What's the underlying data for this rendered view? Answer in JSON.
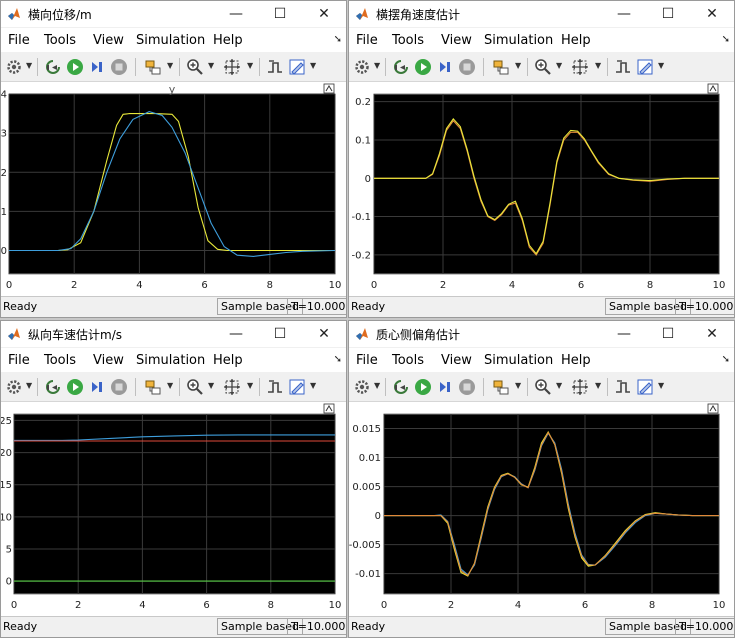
{
  "menu": [
    "File",
    "Tools",
    "View",
    "Simulation",
    "Help"
  ],
  "status": {
    "ready": "Ready",
    "sample": "Sample based",
    "time": "T=10.000"
  },
  "colors": {
    "yellow": "#e8e83a",
    "blue": "#3e9edc",
    "red": "#e04a3a",
    "green": "#5ad048",
    "orange": "#e0883a",
    "grid": "#3a3a3a",
    "bg": "#000000"
  },
  "scopes": [
    {
      "id": "scope1",
      "title": "横向位移/m",
      "axis_title": "y",
      "chart_data": {
        "type": "line",
        "xlim": [
          0,
          10
        ],
        "ylim": [
          -0.6,
          4.0
        ],
        "xticks": [
          0,
          2,
          4,
          6,
          8,
          10
        ],
        "yticks": [
          0,
          1,
          2,
          3,
          4
        ],
        "xtick_labels": [
          "0",
          "2",
          "4",
          "6",
          "8",
          "10"
        ],
        "ytick_labels": [
          "0",
          "1",
          "2",
          "3",
          "4"
        ],
        "grid": true,
        "series": [
          {
            "color": "yellow",
            "x": [
              0,
              1.5,
              1.8,
              2.2,
              2.6,
              3.0,
              3.3,
              3.5,
              3.7,
              4.5,
              5.0,
              5.2,
              5.5,
              5.8,
              6.1,
              6.4,
              6.7,
              7,
              8,
              9,
              10
            ],
            "y": [
              0,
              0,
              0.02,
              0.2,
              1.0,
              2.3,
              3.2,
              3.48,
              3.5,
              3.5,
              3.48,
              3.3,
              2.4,
              1.1,
              0.25,
              0.03,
              0,
              0,
              0,
              0,
              0
            ]
          },
          {
            "color": "blue",
            "x": [
              0,
              1.5,
              1.9,
              2.2,
              2.6,
              3.0,
              3.4,
              3.8,
              4.3,
              4.7,
              5.0,
              5.4,
              5.8,
              6.2,
              6.6,
              7.0,
              7.5,
              8,
              8.5,
              9,
              10
            ],
            "y": [
              0,
              0,
              0.05,
              0.3,
              1.0,
              2.0,
              2.85,
              3.35,
              3.55,
              3.45,
              3.15,
              2.5,
              1.6,
              0.7,
              0.1,
              -0.12,
              -0.15,
              -0.1,
              -0.05,
              -0.02,
              0
            ]
          }
        ]
      }
    },
    {
      "id": "scope2",
      "title": "横摆角速度估计",
      "axis_title": "",
      "chart_data": {
        "type": "line",
        "xlim": [
          0,
          10
        ],
        "ylim": [
          -0.25,
          0.22
        ],
        "xticks": [
          0,
          2,
          4,
          6,
          8,
          10
        ],
        "yticks": [
          -0.2,
          -0.1,
          0,
          0.1,
          0.2
        ],
        "xtick_labels": [
          "0",
          "2",
          "4",
          "6",
          "8",
          "10"
        ],
        "ytick_labels": [
          "-0.2",
          "-0.1",
          "0",
          "0.1",
          "0.2"
        ],
        "grid": true,
        "series": [
          {
            "color": "orange",
            "x": [
              0,
              1.5,
              1.7,
              1.9,
              2.1,
              2.3,
              2.5,
              2.7,
              2.9,
              3.1,
              3.3,
              3.5,
              3.7,
              3.9,
              4.1,
              4.3,
              4.5,
              4.7,
              4.9,
              5.1,
              5.3,
              5.5,
              5.7,
              5.9,
              6.1,
              6.3,
              6.5,
              6.8,
              7.1,
              7.5,
              8.0,
              8.5,
              9,
              10
            ],
            "y": [
              0,
              0,
              0.01,
              0.06,
              0.125,
              0.15,
              0.13,
              0.07,
              0.0,
              -0.06,
              -0.1,
              -0.11,
              -0.095,
              -0.07,
              -0.065,
              -0.11,
              -0.18,
              -0.2,
              -0.17,
              -0.07,
              0.04,
              0.1,
              0.12,
              0.12,
              0.1,
              0.07,
              0.04,
              0.01,
              0,
              -0.005,
              -0.008,
              -0.003,
              0,
              0
            ]
          },
          {
            "color": "yellow",
            "x": [
              0,
              1.5,
              1.7,
              1.9,
              2.1,
              2.3,
              2.5,
              2.7,
              2.9,
              3.1,
              3.3,
              3.5,
              3.7,
              3.9,
              4.1,
              4.3,
              4.5,
              4.7,
              4.9,
              5.1,
              5.3,
              5.5,
              5.7,
              5.9,
              6.1,
              6.3,
              6.5,
              6.8,
              7.1,
              7.5,
              8.0,
              8.5,
              9,
              10
            ],
            "y": [
              0,
              0,
              0.012,
              0.065,
              0.13,
              0.155,
              0.135,
              0.075,
              0.005,
              -0.055,
              -0.098,
              -0.108,
              -0.092,
              -0.068,
              -0.06,
              -0.105,
              -0.175,
              -0.197,
              -0.165,
              -0.065,
              0.045,
              0.105,
              0.125,
              0.123,
              0.103,
              0.072,
              0.043,
              0.012,
              0,
              -0.004,
              -0.006,
              -0.002,
              0,
              0
            ]
          }
        ]
      }
    },
    {
      "id": "scope3",
      "title": "纵向车速估计m/s",
      "axis_title": "",
      "chart_data": {
        "type": "line",
        "xlim": [
          0,
          10
        ],
        "ylim": [
          -2,
          26
        ],
        "xticks": [
          0,
          2,
          4,
          6,
          8,
          10
        ],
        "yticks": [
          0,
          5,
          10,
          15,
          20,
          25
        ],
        "xtick_labels": [
          "0",
          "2",
          "4",
          "6",
          "8",
          "10"
        ],
        "ytick_labels": [
          "0",
          "5",
          "10",
          "15",
          "20",
          "25"
        ],
        "grid": true,
        "series": [
          {
            "color": "blue",
            "x": [
              0,
              1.5,
              2,
              3,
              4,
              5,
              6,
              7,
              8,
              9,
              10
            ],
            "y": [
              21.9,
              21.9,
              21.95,
              22.2,
              22.45,
              22.6,
              22.7,
              22.75,
              22.75,
              22.75,
              22.75
            ]
          },
          {
            "color": "red",
            "x": [
              0,
              10
            ],
            "y": [
              21.8,
              21.8
            ]
          },
          {
            "color": "green",
            "x": [
              0,
              10
            ],
            "y": [
              0,
              0
            ]
          }
        ]
      }
    },
    {
      "id": "scope4",
      "title": "质心侧偏角估计",
      "axis_title": "",
      "chart_data": {
        "type": "line",
        "xlim": [
          0,
          10
        ],
        "ylim": [
          -0.0135,
          0.0175
        ],
        "xticks": [
          0,
          2,
          4,
          6,
          8,
          10
        ],
        "yticks": [
          -0.01,
          -0.005,
          0,
          0.005,
          0.01,
          0.015
        ],
        "xtick_labels": [
          "0",
          "2",
          "4",
          "6",
          "8",
          "10"
        ],
        "ytick_labels": [
          "-0.01",
          "-0.005",
          "0",
          "0.005",
          "0.01",
          "0.015"
        ],
        "grid": true,
        "series": [
          {
            "color": "blue",
            "x": [
              0,
              1.5,
              1.7,
              1.9,
              2.1,
              2.3,
              2.5,
              2.7,
              2.9,
              3.1,
              3.3,
              3.5,
              3.7,
              3.9,
              4.1,
              4.3,
              4.5,
              4.7,
              4.9,
              5.1,
              5.3,
              5.5,
              5.7,
              5.9,
              6.1,
              6.3,
              6.6,
              6.9,
              7.2,
              7.5,
              7.8,
              8.1,
              8.4,
              8.8,
              9.2,
              10
            ],
            "y": [
              0,
              0,
              0.0001,
              -0.001,
              -0.005,
              -0.0092,
              -0.0102,
              -0.0085,
              -0.004,
              0.001,
              0.0045,
              0.0067,
              0.0072,
              0.0067,
              0.0055,
              0.0048,
              0.0078,
              0.012,
              0.0142,
              0.0125,
              0.008,
              0.002,
              -0.003,
              -0.0068,
              -0.0084,
              -0.0085,
              -0.0072,
              -0.0052,
              -0.003,
              -0.0012,
              0,
              0.0004,
              0.0003,
              0.0001,
              0,
              0
            ]
          },
          {
            "color": "yellow",
            "x": [
              0,
              1.5,
              1.7,
              1.9,
              2.1,
              2.3,
              2.5,
              2.7,
              2.9,
              3.1,
              3.3,
              3.5,
              3.7,
              3.9,
              4.1,
              4.3,
              4.5,
              4.7,
              4.9,
              5.1,
              5.3,
              5.5,
              5.7,
              5.9,
              6.1,
              6.3,
              6.6,
              6.9,
              7.2,
              7.5,
              7.8,
              8.1,
              8.4,
              8.8,
              9.2,
              10
            ],
            "y": [
              0,
              0,
              0,
              -0.0013,
              -0.0058,
              -0.0098,
              -0.0104,
              -0.0082,
              -0.0034,
              0.0015,
              0.0049,
              0.0069,
              0.0073,
              0.0066,
              0.0053,
              0.0049,
              0.0083,
              0.0125,
              0.0144,
              0.0122,
              0.0073,
              0.0012,
              -0.0037,
              -0.0073,
              -0.0087,
              -0.0085,
              -0.0069,
              -0.0048,
              -0.0026,
              -0.0009,
              0.0002,
              0.0005,
              0.0003,
              0.0001,
              0,
              0
            ]
          },
          {
            "color": "orange",
            "x": [
              0,
              1.5,
              1.7,
              1.9,
              2.1,
              2.3,
              2.5,
              2.7,
              2.9,
              3.1,
              3.3,
              3.5,
              3.7,
              3.9,
              4.1,
              4.3,
              4.5,
              4.7,
              4.9,
              5.1,
              5.3,
              5.5,
              5.7,
              5.9,
              6.1,
              6.3,
              6.6,
              6.9,
              7.2,
              7.5,
              7.8,
              8.1,
              8.4,
              8.8,
              9.2,
              10
            ],
            "y": [
              0,
              0,
              0,
              -0.0011,
              -0.0054,
              -0.0095,
              -0.0103,
              -0.0083,
              -0.0037,
              0.0012,
              0.0047,
              0.0068,
              0.0072,
              0.0066,
              0.0054,
              0.0048,
              0.008,
              0.0122,
              0.0143,
              0.0123,
              0.0076,
              0.0016,
              -0.0034,
              -0.007,
              -0.0085,
              -0.0085,
              -0.007,
              -0.005,
              -0.0028,
              -0.001,
              0.0001,
              0.0004,
              0.0003,
              0.0001,
              0,
              0
            ]
          }
        ]
      }
    }
  ]
}
